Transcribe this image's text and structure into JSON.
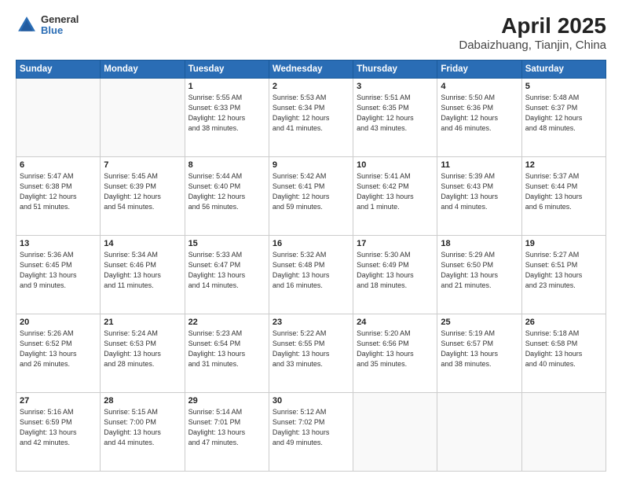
{
  "header": {
    "logo_line1": "General",
    "logo_line2": "Blue",
    "title": "April 2025",
    "subtitle": "Dabaizhuang, Tianjin, China"
  },
  "days_of_week": [
    "Sunday",
    "Monday",
    "Tuesday",
    "Wednesday",
    "Thursday",
    "Friday",
    "Saturday"
  ],
  "weeks": [
    [
      {
        "day": "",
        "info": ""
      },
      {
        "day": "",
        "info": ""
      },
      {
        "day": "1",
        "info": "Sunrise: 5:55 AM\nSunset: 6:33 PM\nDaylight: 12 hours\nand 38 minutes."
      },
      {
        "day": "2",
        "info": "Sunrise: 5:53 AM\nSunset: 6:34 PM\nDaylight: 12 hours\nand 41 minutes."
      },
      {
        "day": "3",
        "info": "Sunrise: 5:51 AM\nSunset: 6:35 PM\nDaylight: 12 hours\nand 43 minutes."
      },
      {
        "day": "4",
        "info": "Sunrise: 5:50 AM\nSunset: 6:36 PM\nDaylight: 12 hours\nand 46 minutes."
      },
      {
        "day": "5",
        "info": "Sunrise: 5:48 AM\nSunset: 6:37 PM\nDaylight: 12 hours\nand 48 minutes."
      }
    ],
    [
      {
        "day": "6",
        "info": "Sunrise: 5:47 AM\nSunset: 6:38 PM\nDaylight: 12 hours\nand 51 minutes."
      },
      {
        "day": "7",
        "info": "Sunrise: 5:45 AM\nSunset: 6:39 PM\nDaylight: 12 hours\nand 54 minutes."
      },
      {
        "day": "8",
        "info": "Sunrise: 5:44 AM\nSunset: 6:40 PM\nDaylight: 12 hours\nand 56 minutes."
      },
      {
        "day": "9",
        "info": "Sunrise: 5:42 AM\nSunset: 6:41 PM\nDaylight: 12 hours\nand 59 minutes."
      },
      {
        "day": "10",
        "info": "Sunrise: 5:41 AM\nSunset: 6:42 PM\nDaylight: 13 hours\nand 1 minute."
      },
      {
        "day": "11",
        "info": "Sunrise: 5:39 AM\nSunset: 6:43 PM\nDaylight: 13 hours\nand 4 minutes."
      },
      {
        "day": "12",
        "info": "Sunrise: 5:37 AM\nSunset: 6:44 PM\nDaylight: 13 hours\nand 6 minutes."
      }
    ],
    [
      {
        "day": "13",
        "info": "Sunrise: 5:36 AM\nSunset: 6:45 PM\nDaylight: 13 hours\nand 9 minutes."
      },
      {
        "day": "14",
        "info": "Sunrise: 5:34 AM\nSunset: 6:46 PM\nDaylight: 13 hours\nand 11 minutes."
      },
      {
        "day": "15",
        "info": "Sunrise: 5:33 AM\nSunset: 6:47 PM\nDaylight: 13 hours\nand 14 minutes."
      },
      {
        "day": "16",
        "info": "Sunrise: 5:32 AM\nSunset: 6:48 PM\nDaylight: 13 hours\nand 16 minutes."
      },
      {
        "day": "17",
        "info": "Sunrise: 5:30 AM\nSunset: 6:49 PM\nDaylight: 13 hours\nand 18 minutes."
      },
      {
        "day": "18",
        "info": "Sunrise: 5:29 AM\nSunset: 6:50 PM\nDaylight: 13 hours\nand 21 minutes."
      },
      {
        "day": "19",
        "info": "Sunrise: 5:27 AM\nSunset: 6:51 PM\nDaylight: 13 hours\nand 23 minutes."
      }
    ],
    [
      {
        "day": "20",
        "info": "Sunrise: 5:26 AM\nSunset: 6:52 PM\nDaylight: 13 hours\nand 26 minutes."
      },
      {
        "day": "21",
        "info": "Sunrise: 5:24 AM\nSunset: 6:53 PM\nDaylight: 13 hours\nand 28 minutes."
      },
      {
        "day": "22",
        "info": "Sunrise: 5:23 AM\nSunset: 6:54 PM\nDaylight: 13 hours\nand 31 minutes."
      },
      {
        "day": "23",
        "info": "Sunrise: 5:22 AM\nSunset: 6:55 PM\nDaylight: 13 hours\nand 33 minutes."
      },
      {
        "day": "24",
        "info": "Sunrise: 5:20 AM\nSunset: 6:56 PM\nDaylight: 13 hours\nand 35 minutes."
      },
      {
        "day": "25",
        "info": "Sunrise: 5:19 AM\nSunset: 6:57 PM\nDaylight: 13 hours\nand 38 minutes."
      },
      {
        "day": "26",
        "info": "Sunrise: 5:18 AM\nSunset: 6:58 PM\nDaylight: 13 hours\nand 40 minutes."
      }
    ],
    [
      {
        "day": "27",
        "info": "Sunrise: 5:16 AM\nSunset: 6:59 PM\nDaylight: 13 hours\nand 42 minutes."
      },
      {
        "day": "28",
        "info": "Sunrise: 5:15 AM\nSunset: 7:00 PM\nDaylight: 13 hours\nand 44 minutes."
      },
      {
        "day": "29",
        "info": "Sunrise: 5:14 AM\nSunset: 7:01 PM\nDaylight: 13 hours\nand 47 minutes."
      },
      {
        "day": "30",
        "info": "Sunrise: 5:12 AM\nSunset: 7:02 PM\nDaylight: 13 hours\nand 49 minutes."
      },
      {
        "day": "",
        "info": ""
      },
      {
        "day": "",
        "info": ""
      },
      {
        "day": "",
        "info": ""
      }
    ]
  ]
}
